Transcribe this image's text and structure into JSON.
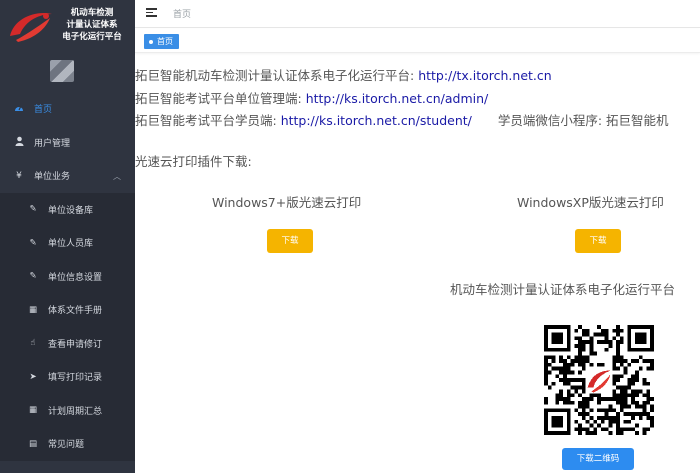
{
  "brand": {
    "line1": "机动车检测",
    "line2": "计量认证体系",
    "line3": "电子化运行平台"
  },
  "sidebar": {
    "items": [
      {
        "label": "首页",
        "icon": "dashboard-icon",
        "active": true
      },
      {
        "label": "用户管理",
        "icon": "user-icon"
      },
      {
        "label": "单位业务",
        "icon": "yen-icon",
        "expanded": true
      },
      {
        "label": "单位设备库",
        "icon": "edit-icon",
        "sub": true
      },
      {
        "label": "单位人员库",
        "icon": "edit-icon",
        "sub": true
      },
      {
        "label": "单位信息设置",
        "icon": "edit-icon",
        "sub": true
      },
      {
        "label": "体系文件手册",
        "icon": "table-icon",
        "sub": true
      },
      {
        "label": "查看申请修订",
        "icon": "hand-icon",
        "sub": true
      },
      {
        "label": "填写打印记录",
        "icon": "send-icon",
        "sub": true
      },
      {
        "label": "计划周期汇总",
        "icon": "table-icon",
        "sub": true
      },
      {
        "label": "常见问题",
        "icon": "doc-icon",
        "sub": true
      }
    ]
  },
  "header": {
    "breadcrumb": "首页"
  },
  "tags": {
    "active": "首页"
  },
  "main": {
    "lines": [
      {
        "label": "拓巨智能机动车检测计量认证体系电子化运行平台: ",
        "link": "http://tx.itorch.net.cn"
      },
      {
        "label": "拓巨智能考试平台单位管理端: ",
        "link": "http://ks.itorch.net.cn/admin/"
      },
      {
        "label": "拓巨智能考试平台学员端: ",
        "link": "http://ks.itorch.net.cn/student/",
        "extra": "学员端微信小程序: 拓巨智能机"
      }
    ],
    "plugin_title": "光速云打印插件下载:",
    "downloads": [
      {
        "title": "Windows7+版光速云打印",
        "button": "下载"
      },
      {
        "title": "WindowsXP版光速云打印",
        "button": "下载"
      }
    ],
    "qr_title": "机动车检测计量认证体系电子化运行平台",
    "qr_button": "下载二维码"
  },
  "colors": {
    "sidebar_bg": "#2f3440",
    "accent": "#3a8ee6",
    "download": "#f5b400",
    "qr_button": "#2d8cf0",
    "link": "#1a1aa6"
  }
}
